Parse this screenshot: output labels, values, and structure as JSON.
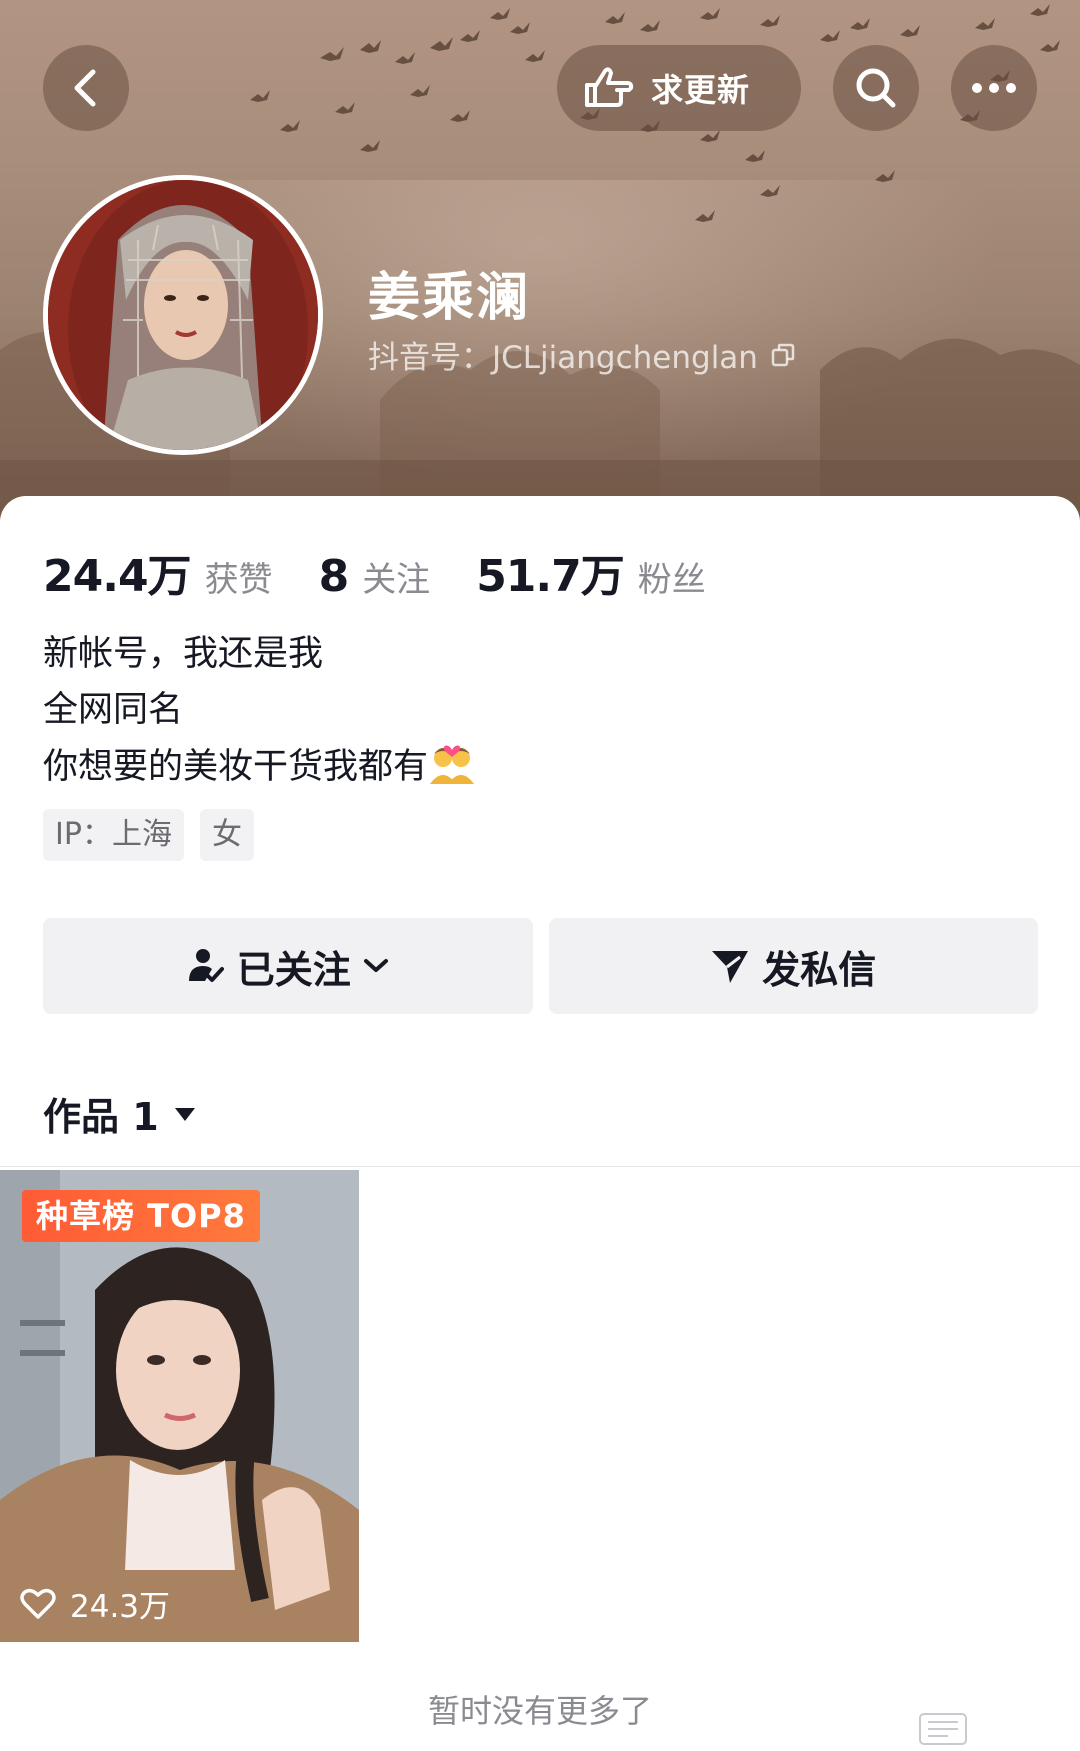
{
  "header": {
    "request_update_label": "求更新",
    "back_icon": "chevron-left-icon",
    "search_icon": "search-icon",
    "more_icon": "more-dots-icon",
    "request_icon": "pointing-hand-icon"
  },
  "profile": {
    "name": "姜乘澜",
    "douyin_id": "抖音号：JCLjiangchenglan",
    "copy_icon": "copy-icon"
  },
  "stats": [
    {
      "value": "24.4万",
      "label": "获赞"
    },
    {
      "value": "8",
      "label": "关注"
    },
    {
      "value": "51.7万",
      "label": "粉丝"
    }
  ],
  "bio": {
    "line1": "新帐号，我还是我",
    "line2": "全网同名",
    "line3": "你想要的美妆干货我都有",
    "emoji": "couple-with-heart-icon"
  },
  "tags": {
    "ip": "IP：上海",
    "gender": "女"
  },
  "actions": {
    "follow_label": "已关注",
    "message_label": "发私信"
  },
  "works": {
    "tab_label": "作品 1",
    "items": [
      {
        "badge": "种草榜 TOP8",
        "likes": "24.3万"
      }
    ]
  },
  "footer": {
    "no_more": "暂时没有更多了"
  },
  "colors": {
    "badge_orange": "#ff5b36",
    "text_primary": "#161823",
    "text_secondary": "#8a8b91"
  }
}
